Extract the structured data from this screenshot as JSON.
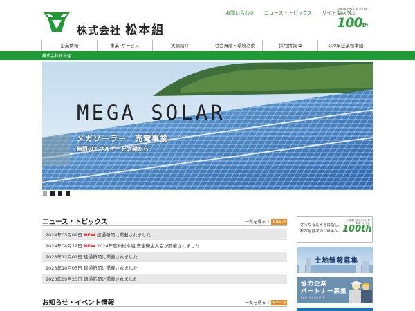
{
  "header": {
    "company_prefix": "株式会社",
    "company_main": "松本組",
    "util_links": [
      "お問い合わせ",
      "ニュース・トピックス",
      "サイトマップ"
    ],
    "anniversary_tag1": "お客様と歩んだ100年",
    "anniversary_tag2": "未来へともに",
    "anniversary_num": "100",
    "anniversary_suffix": "th"
  },
  "nav": {
    "items": [
      "企業情報",
      "事業･サービス",
      "実績紹介",
      "社会貢献・環境活動",
      "採用情報",
      "100年企業松本組"
    ]
  },
  "breadcrumb": "株式会社松本組",
  "hero": {
    "title": "MEGA SOLAR",
    "subtitle": "メガソーラー　売電事業",
    "tagline": "無限のエネルギーを太陽から"
  },
  "news": {
    "title": "ニュース・トピックス",
    "more_label": "一覧を見る",
    "rss_label": "RSS",
    "new_label": "NEW",
    "items": [
      {
        "date": "2024年05月09日",
        "text": "建通新聞に掲載されました",
        "new": true
      },
      {
        "date": "2024年04月22日",
        "text": "2024年度㈱松本組 安全衛生大会が開催されました",
        "new": true
      },
      {
        "date": "2023年12月01日",
        "text": "建通新聞に掲載されました",
        "new": false
      },
      {
        "date": "2023年10月05日",
        "text": "建通新聞に掲載されました",
        "new": false
      },
      {
        "date": "2023年09月20日",
        "text": "建通新聞に掲載されました",
        "new": false
      }
    ]
  },
  "events": {
    "title": "お知らせ・イベント情報",
    "more_label": "一覧を見る",
    "rss_label": "RSS"
  },
  "side": {
    "banner1_line1": "さらなる高みを目指し、",
    "banner1_line2": "松本組は次の100年へ。",
    "banner1_tag1": "お客様と歩んだ100年",
    "banner1_tag2": "未来へともに",
    "banner1_num": "100th",
    "banner2_label": "土地情報募集",
    "banner3_line1": "協力企業",
    "banner3_line2": "パートナー募集",
    "banner3_small": "PARTNERSHIP"
  },
  "colors": {
    "brand_green": "#1e9b37",
    "new_red": "#e0201c",
    "rss_orange": "#f08a1e"
  }
}
